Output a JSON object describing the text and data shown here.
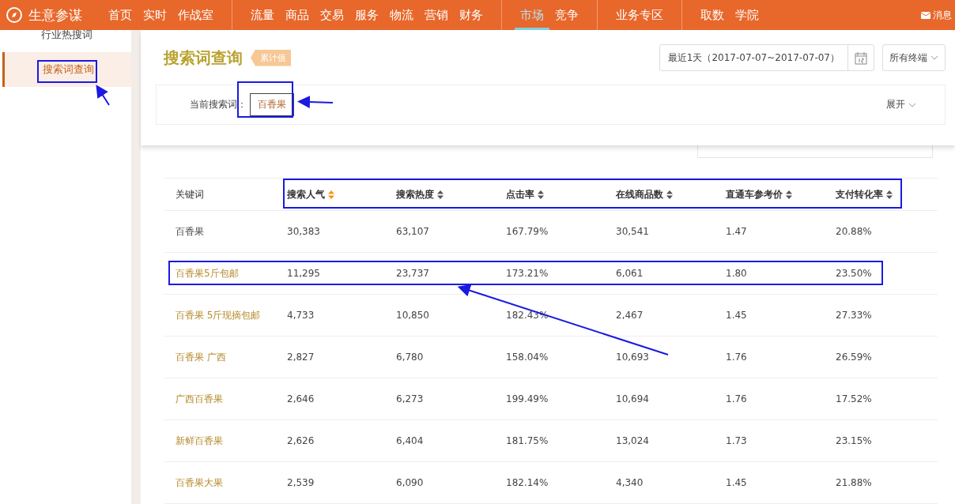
{
  "topbar": {
    "logo": "生意参谋",
    "nav_groups": [
      [
        {
          "label": "首页",
          "selected": false
        },
        {
          "label": "实时",
          "selected": false
        },
        {
          "label": "作战室",
          "selected": false
        }
      ],
      [
        {
          "label": "流量",
          "selected": false
        },
        {
          "label": "商品",
          "selected": false
        },
        {
          "label": "交易",
          "selected": false
        },
        {
          "label": "服务",
          "selected": false
        },
        {
          "label": "物流",
          "selected": false
        },
        {
          "label": "营销",
          "selected": false
        },
        {
          "label": "财务",
          "selected": false
        }
      ],
      [
        {
          "label": "市场",
          "selected": true
        },
        {
          "label": "竞争",
          "selected": false
        }
      ],
      [
        {
          "label": "业务专区",
          "selected": false
        }
      ],
      [
        {
          "label": "取数",
          "selected": false
        },
        {
          "label": "学院",
          "selected": false
        }
      ]
    ],
    "messages": "消息"
  },
  "sidebar": {
    "items": [
      {
        "label": "行业热搜词",
        "selected": false
      },
      {
        "label": "搜索词查询",
        "selected": true
      }
    ]
  },
  "header": {
    "title": "搜索词查询",
    "badge": "累计值",
    "date_range": "最近1天（2017-07-07~2017-07-07）",
    "terminal": "所有终端",
    "current_label": "当前搜索词：",
    "current_term": "百香果",
    "expand": "展开"
  },
  "table": {
    "columns": [
      {
        "label": "关键词"
      },
      {
        "label": "搜索人气",
        "sorted": true
      },
      {
        "label": "搜索热度",
        "sorted": false
      },
      {
        "label": "点击率",
        "sorted": false
      },
      {
        "label": "在线商品数",
        "sorted": false
      },
      {
        "label": "直通车参考价",
        "sorted": false
      },
      {
        "label": "支付转化率",
        "sorted": false
      }
    ],
    "rows": [
      {
        "linked": false,
        "cells": [
          "百香果",
          "30,383",
          "63,107",
          "167.79%",
          "30,541",
          "1.47",
          "20.88%"
        ]
      },
      {
        "linked": true,
        "cells": [
          "百香果5斤包邮",
          "11,295",
          "23,737",
          "173.21%",
          "6,061",
          "1.80",
          "23.50%"
        ]
      },
      {
        "linked": true,
        "cells": [
          "百香果 5斤现摘包邮",
          "4,733",
          "10,850",
          "182.43%",
          "2,467",
          "1.45",
          "27.33%"
        ]
      },
      {
        "linked": true,
        "cells": [
          "百香果 广西",
          "2,827",
          "6,780",
          "158.04%",
          "10,693",
          "1.76",
          "26.59%"
        ]
      },
      {
        "linked": true,
        "cells": [
          "广西百香果",
          "2,646",
          "6,273",
          "199.49%",
          "10,694",
          "1.76",
          "17.52%"
        ]
      },
      {
        "linked": true,
        "cells": [
          "新鲜百香果",
          "2,626",
          "6,404",
          "181.75%",
          "13,024",
          "1.73",
          "23.15%"
        ]
      },
      {
        "linked": true,
        "cells": [
          "百香果大果",
          "2,539",
          "6,090",
          "182.14%",
          "4,340",
          "1.45",
          "21.88%"
        ]
      }
    ]
  }
}
